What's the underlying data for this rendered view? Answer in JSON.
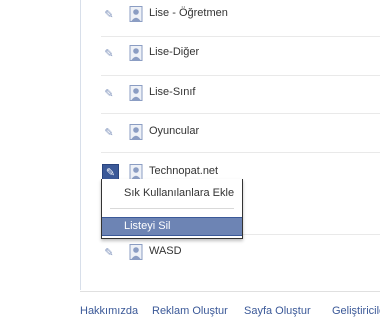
{
  "friend_lists": [
    {
      "label": "Lise - Öğretmen"
    },
    {
      "label": "Lise-Diğer"
    },
    {
      "label": "Lise-Sınıf"
    },
    {
      "label": "Oyuncular"
    },
    {
      "label": "Technopat.net"
    },
    {
      "label": "WASD"
    }
  ],
  "context_menu": {
    "add_to_favorites": "Sık Kullanılanlara Ekle",
    "delete_list": "Listeyi Sil"
  },
  "footer": {
    "about": "Hakkımızda",
    "create_ad": "Reklam Oluştur",
    "create_page": "Sayfa Oluştur",
    "developers": "Geliştiriciler"
  },
  "colors": {
    "link": "#3b5998",
    "menu_highlight": "#6d84b4",
    "icon": "#7f93bc"
  },
  "icons": {
    "edit": "pencil-icon",
    "list": "person-icon"
  }
}
